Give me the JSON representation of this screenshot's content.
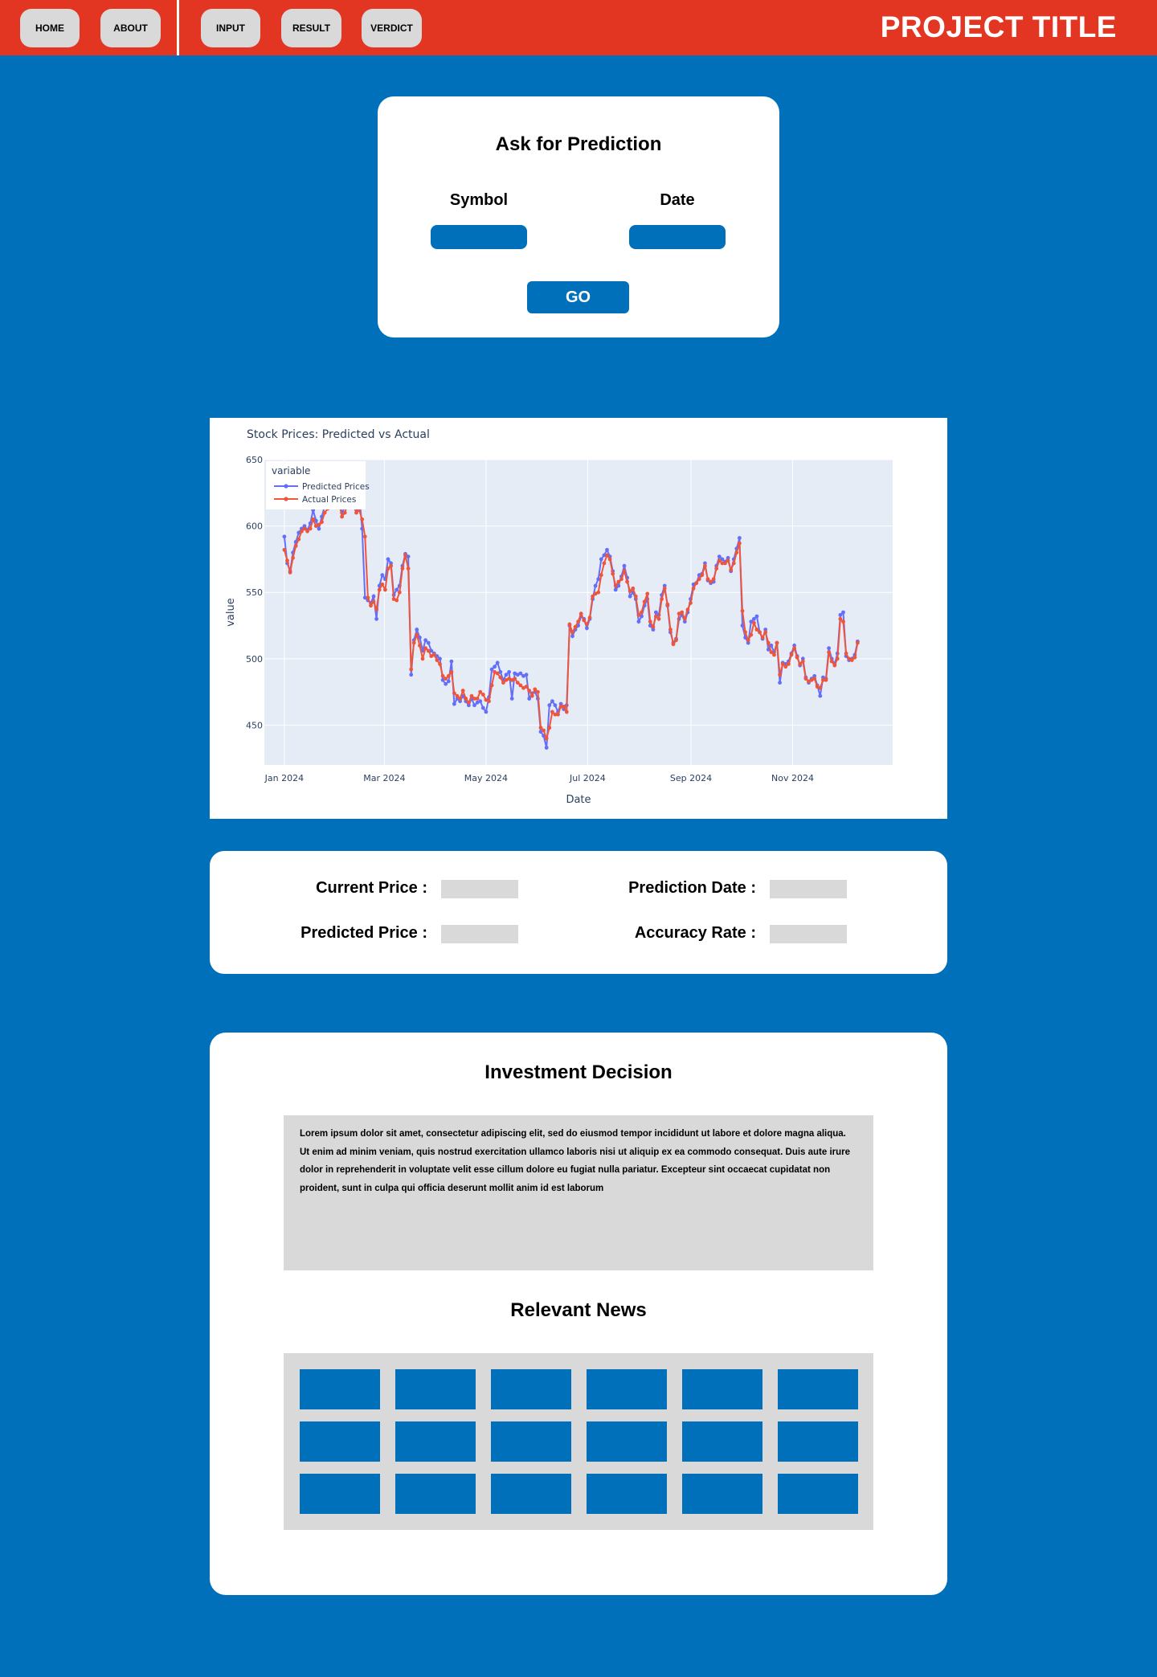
{
  "nav": {
    "items": [
      {
        "label": "HOME"
      },
      {
        "label": "ABOUT"
      },
      {
        "label": "INPUT"
      },
      {
        "label": "RESULT"
      },
      {
        "label": "VERDICT"
      }
    ],
    "project_title": "PROJECT TITLE"
  },
  "colors": {
    "navbar": "#e33622",
    "page_bg": "#0070bb",
    "card_bg": "#ffffff",
    "accent": "#0070bb",
    "placeholder_gray": "#d9d9d9"
  },
  "prediction_form": {
    "title": "Ask for Prediction",
    "symbol_label": "Symbol",
    "symbol_value": "",
    "date_label": "Date",
    "date_value": "",
    "go_label": "GO"
  },
  "chart_data": {
    "type": "line",
    "title": "Stock Prices: Predicted vs Actual",
    "xlabel": "Date",
    "ylabel": "value",
    "x_start": "2024-01-01",
    "x_end": "2024-12-10",
    "xlim": [
      "2023-12-20",
      "2024-12-31"
    ],
    "ylim": [
      420,
      650
    ],
    "x_ticks": [
      {
        "date": "2024-01-01",
        "label": "Jan 2024"
      },
      {
        "date": "2024-03-01",
        "label": "Mar 2024"
      },
      {
        "date": "2024-05-01",
        "label": "May 2024"
      },
      {
        "date": "2024-07-01",
        "label": "Jul 2024"
      },
      {
        "date": "2024-09-01",
        "label": "Sep 2024"
      },
      {
        "date": "2024-11-01",
        "label": "Nov 2024"
      }
    ],
    "y_ticks": [
      450,
      500,
      550,
      600,
      650
    ],
    "grid": true,
    "legend": {
      "title": "variable",
      "position": "top-left"
    },
    "series": [
      {
        "name": "Predicted Prices",
        "color": "#636efa",
        "values": [
          592,
          572,
          566,
          580,
          588,
          595,
          598,
          600,
          597,
          602,
          612,
          604,
          598,
          607,
          615,
          618,
          622,
          630,
          628,
          620,
          610,
          614,
          622,
          626,
          620,
          612,
          624,
          598,
          546,
          544,
          542,
          547,
          530,
          555,
          563,
          560,
          575,
          572,
          548,
          552,
          555,
          570,
          579,
          577,
          488,
          514,
          522,
          516,
          506,
          514,
          512,
          506,
          504,
          502,
          500,
          484,
          481,
          483,
          498,
          466,
          470,
          468,
          472,
          468,
          465,
          470,
          465,
          467,
          468,
          463,
          460,
          471,
          492,
          494,
          497,
          490,
          484,
          488,
          490,
          470,
          489,
          488,
          489,
          487,
          488,
          470,
          474,
          475,
          470,
          445,
          442,
          433,
          465,
          468,
          465,
          460,
          466,
          462,
          465,
          525,
          517,
          522,
          525,
          532,
          530,
          523,
          530,
          545,
          555,
          560,
          575,
          578,
          582,
          577,
          566,
          552,
          555,
          562,
          570,
          561,
          547,
          550,
          545,
          528,
          532,
          540,
          545,
          525,
          522,
          535,
          533,
          548,
          555,
          540,
          520,
          512,
          515,
          530,
          533,
          528,
          535,
          545,
          556,
          557,
          563,
          564,
          572,
          559,
          557,
          558,
          570,
          577,
          575,
          573,
          576,
          566,
          575,
          583,
          591,
          525,
          516,
          512,
          528,
          530,
          532,
          520,
          515,
          522,
          507,
          510,
          505,
          512,
          482,
          497,
          496,
          498,
          504,
          510,
          502,
          495,
          500,
          486,
          482,
          485,
          487,
          480,
          472,
          486,
          485,
          508,
          500,
          496,
          504,
          533,
          535,
          502,
          499,
          500,
          503,
          513
        ]
      },
      {
        "name": "Actual Prices",
        "color": "#ef553b",
        "values": [
          582,
          574,
          565,
          576,
          585,
          590,
          596,
          598,
          596,
          598,
          605,
          600,
          601,
          603,
          610,
          613,
          616,
          626,
          624,
          618,
          607,
          610,
          617,
          620,
          617,
          610,
          612,
          605,
          592,
          546,
          540,
          543,
          537,
          552,
          556,
          552,
          568,
          570,
          545,
          544,
          550,
          568,
          578,
          568,
          492,
          512,
          518,
          510,
          500,
          508,
          506,
          502,
          503,
          499,
          496,
          487,
          485,
          487,
          490,
          474,
          472,
          470,
          476,
          470,
          467,
          472,
          470,
          470,
          475,
          473,
          469,
          468,
          480,
          490,
          489,
          486,
          482,
          484,
          485,
          484,
          485,
          482,
          480,
          478,
          479,
          476,
          472,
          477,
          475,
          448,
          446,
          440,
          448,
          460,
          458,
          458,
          464,
          464,
          460,
          526,
          520,
          524,
          528,
          534,
          529,
          526,
          531,
          547,
          549,
          550,
          563,
          572,
          578,
          575,
          564,
          555,
          558,
          560,
          566,
          558,
          551,
          553,
          547,
          533,
          535,
          543,
          549,
          528,
          524,
          532,
          530,
          545,
          553,
          541,
          522,
          511,
          514,
          534,
          535,
          530,
          537,
          542,
          553,
          557,
          560,
          563,
          570,
          560,
          558,
          560,
          568,
          574,
          572,
          572,
          574,
          567,
          572,
          580,
          587,
          536,
          520,
          514,
          518,
          527,
          522,
          520,
          516,
          520,
          512,
          505,
          503,
          512,
          488,
          496,
          494,
          496,
          503,
          508,
          501,
          496,
          498,
          485,
          483,
          484,
          485,
          479,
          478,
          484,
          484,
          505,
          498,
          495,
          500,
          530,
          528,
          504,
          500,
          499,
          501,
          512
        ]
      }
    ]
  },
  "results": {
    "current_price_label": "Current Price :",
    "current_price_value": "",
    "predicted_price_label": "Predicted Price :",
    "predicted_price_value": "",
    "prediction_date_label": "Prediction Date :",
    "prediction_date_value": "",
    "accuracy_rate_label": "Accuracy Rate :",
    "accuracy_rate_value": ""
  },
  "verdict": {
    "decision_title": "Investment Decision",
    "decision_text": "Lorem ipsum dolor sit amet, consectetur adipiscing elit, sed do eiusmod tempor incididunt ut labore et dolore magna aliqua. Ut enim ad minim veniam, quis nostrud exercitation ullamco laboris nisi ut aliquip ex ea commodo consequat. Duis aute irure dolor in reprehenderit in voluptate velit esse cillum dolore eu fugiat nulla pariatur. Excepteur sint occaecat cupidatat non proident, sunt in culpa qui officia deserunt mollit anim id est laborum",
    "news_title": "Relevant News",
    "news_rows": 3,
    "news_cols": 6
  }
}
